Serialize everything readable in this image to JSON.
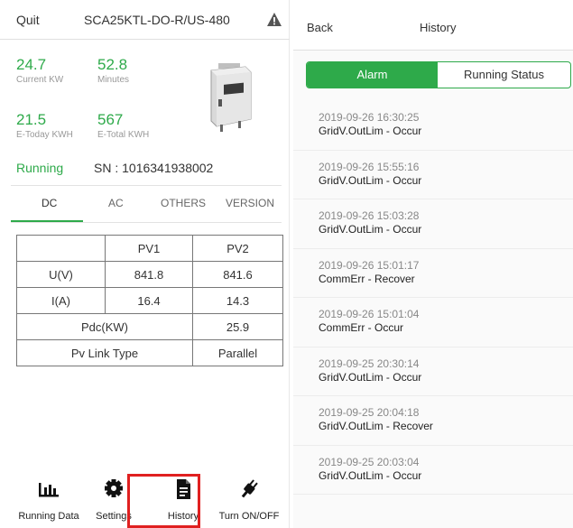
{
  "left": {
    "topbar": {
      "quit": "Quit",
      "model": "SCA25KTL-DO-R/US-480",
      "warning_icon": "warning-icon"
    },
    "metrics": [
      {
        "value": "24.7",
        "label": "Current KW"
      },
      {
        "value": "52.8",
        "label": "Minutes"
      },
      {
        "value": "21.5",
        "label": "E-Today KWH"
      },
      {
        "value": "567",
        "label": "E-Total KWH"
      }
    ],
    "status": "Running",
    "sn": "SN : 1016341938002",
    "tabs": [
      "DC",
      "AC",
      "OTHERS",
      "VERSION"
    ],
    "active_tab": "DC",
    "table": {
      "header": [
        "",
        "PV1",
        "PV2"
      ],
      "rows": [
        {
          "label": "U(V)",
          "pv1": "841.8",
          "pv2": "841.6"
        },
        {
          "label": "I(A)",
          "pv1": "16.4",
          "pv2": "14.3"
        }
      ],
      "pdc": {
        "label": "Pdc(KW)",
        "value": "25.9"
      },
      "link": {
        "label": "Pv Link Type",
        "value": "Parallel"
      }
    },
    "nav": [
      {
        "label": "Running Data",
        "icon": "bar-chart-icon"
      },
      {
        "label": "Settings",
        "icon": "gear-icon"
      },
      {
        "label": "History",
        "icon": "document-icon"
      },
      {
        "label": "Turn ON/OFF",
        "icon": "plug-icon"
      }
    ]
  },
  "right": {
    "back": "Back",
    "title": "History",
    "segments": [
      "Alarm",
      "Running Status"
    ],
    "active_segment": "Alarm",
    "events": [
      {
        "time": "2019-09-26 16:30:25",
        "event": "GridV.OutLim - Occur"
      },
      {
        "time": "2019-09-26 15:55:16",
        "event": "GridV.OutLim - Occur"
      },
      {
        "time": "2019-09-26 15:03:28",
        "event": "GridV.OutLim - Occur"
      },
      {
        "time": "2019-09-26 15:01:17",
        "event": "CommErr - Recover"
      },
      {
        "time": "2019-09-26 15:01:04",
        "event": "CommErr - Occur"
      },
      {
        "time": "2019-09-25 20:30:14",
        "event": "GridV.OutLim - Occur"
      },
      {
        "time": "2019-09-25 20:04:18",
        "event": "GridV.OutLim - Recover"
      },
      {
        "time": "2019-09-25 20:03:04",
        "event": "GridV.OutLim - Occur"
      }
    ]
  },
  "colors": {
    "accent": "#2eaa4a",
    "highlight": "#e02020"
  }
}
